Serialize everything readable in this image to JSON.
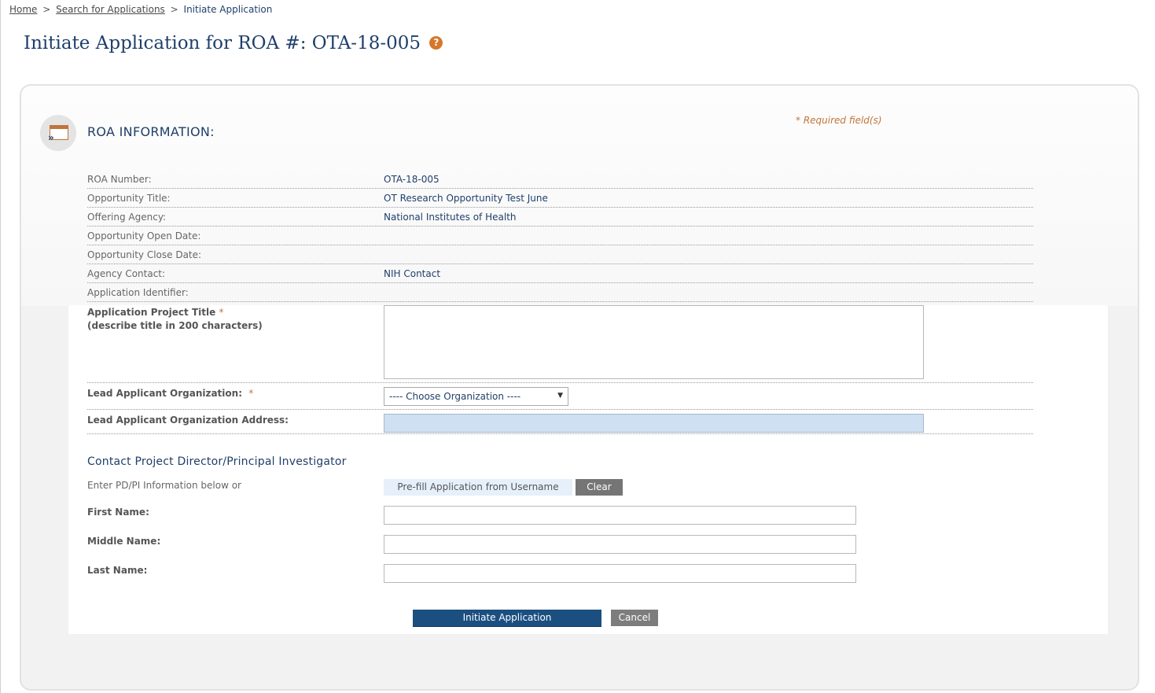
{
  "breadcrumb": {
    "home": "Home",
    "separator": ">",
    "search": "Search for Applications",
    "current": "Initiate Application"
  },
  "page": {
    "title": "Initiate Application for ROA #: OTA-18-005",
    "help_glyph": "?"
  },
  "section": {
    "title": "ROA INFORMATION:",
    "icon": "window-arrow-icon",
    "required_note": "* Required field(s)"
  },
  "info": [
    {
      "label": "ROA Number:",
      "value": "OTA-18-005"
    },
    {
      "label": "Opportunity Title:",
      "value": "OT Research Opportunity Test June"
    },
    {
      "label": "Offering Agency:",
      "value": "National Institutes of Health"
    },
    {
      "label": "Opportunity Open Date:",
      "value": ""
    },
    {
      "label": "Opportunity Close Date:",
      "value": ""
    },
    {
      "label": "Agency Contact:",
      "value": "NIH Contact"
    },
    {
      "label": "Application Identifier:",
      "value": ""
    }
  ],
  "form": {
    "project_title_label": "Application Project Title",
    "project_title_hint": "(describe title in 200 characters)",
    "required_marker": "*",
    "project_title_value": "",
    "lead_org_label": "Lead Applicant Organization:",
    "lead_org_selected": "---- Choose Organization ----",
    "lead_org_address_label": "Lead Applicant Organization Address:",
    "lead_org_address_value": ""
  },
  "contact": {
    "heading": "Contact Project Director/Principal Investigator",
    "enter_label": "Enter PD/PI Information below or",
    "prefill_button": "Pre-fill Application from Username",
    "clear_button": "Clear",
    "first_name_label": "First Name:",
    "middle_name_label": "Middle Name:",
    "last_name_label": "Last Name:",
    "first_name_value": "",
    "middle_name_value": "",
    "last_name_value": ""
  },
  "actions": {
    "initiate": "Initiate Application",
    "cancel": "Cancel"
  },
  "colors": {
    "title_blue": "#1f3f6a",
    "accent_orange": "#c0743b",
    "primary_button": "#1b4f80",
    "secondary_button": "#7d7d7d",
    "address_fill": "#cfe0f3"
  }
}
